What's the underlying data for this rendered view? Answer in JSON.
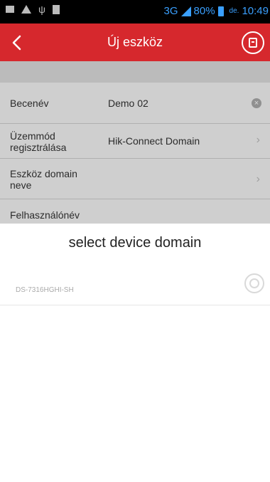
{
  "status_bar": {
    "network": "3G",
    "battery_percent": "80%",
    "ampm": "de.",
    "time": "10:49"
  },
  "header": {
    "title": "Új eszköz"
  },
  "form": {
    "nickname_label": "Becenév",
    "nickname_value": "Demo 02",
    "reg_mode_label": "Üzemmód\nregisztrálása",
    "reg_mode_value": "Hik-Connect Domain",
    "domain_label": "Eszköz domain\nneve",
    "username_label": "Felhasználónév"
  },
  "sheet": {
    "title": "select device domain",
    "items": [
      {
        "name": "DS-7316HGHI-SH"
      }
    ]
  }
}
